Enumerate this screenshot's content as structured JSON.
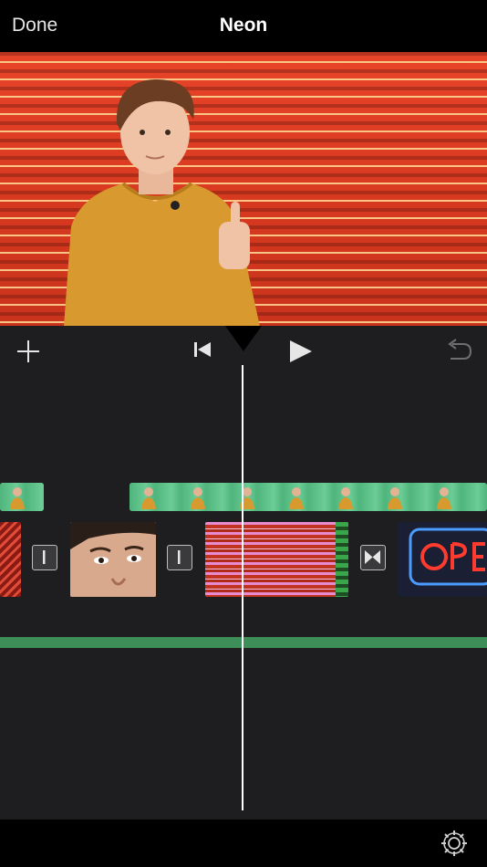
{
  "header": {
    "done_label": "Done",
    "title": "Neon"
  },
  "toolbar": {
    "add_icon": "plus-icon",
    "skip_start_icon": "skip-to-start-icon",
    "play_icon": "play-icon",
    "undo_icon": "undo-icon"
  },
  "timeline": {
    "transitions": [
      "cut",
      "cut",
      "cross-dissolve"
    ],
    "clips": [
      "neon-lights",
      "face-closeup",
      "pink-neon",
      "open-sign"
    ],
    "overlay_track": "green-screen"
  },
  "bottombar": {
    "settings_icon": "gear-icon"
  },
  "colors": {
    "background": "#000000",
    "timeline": "#1e1e20",
    "green_screen": "#5fc08a",
    "audio_track": "#3e8e5a",
    "neon_red": "#d93a20"
  }
}
